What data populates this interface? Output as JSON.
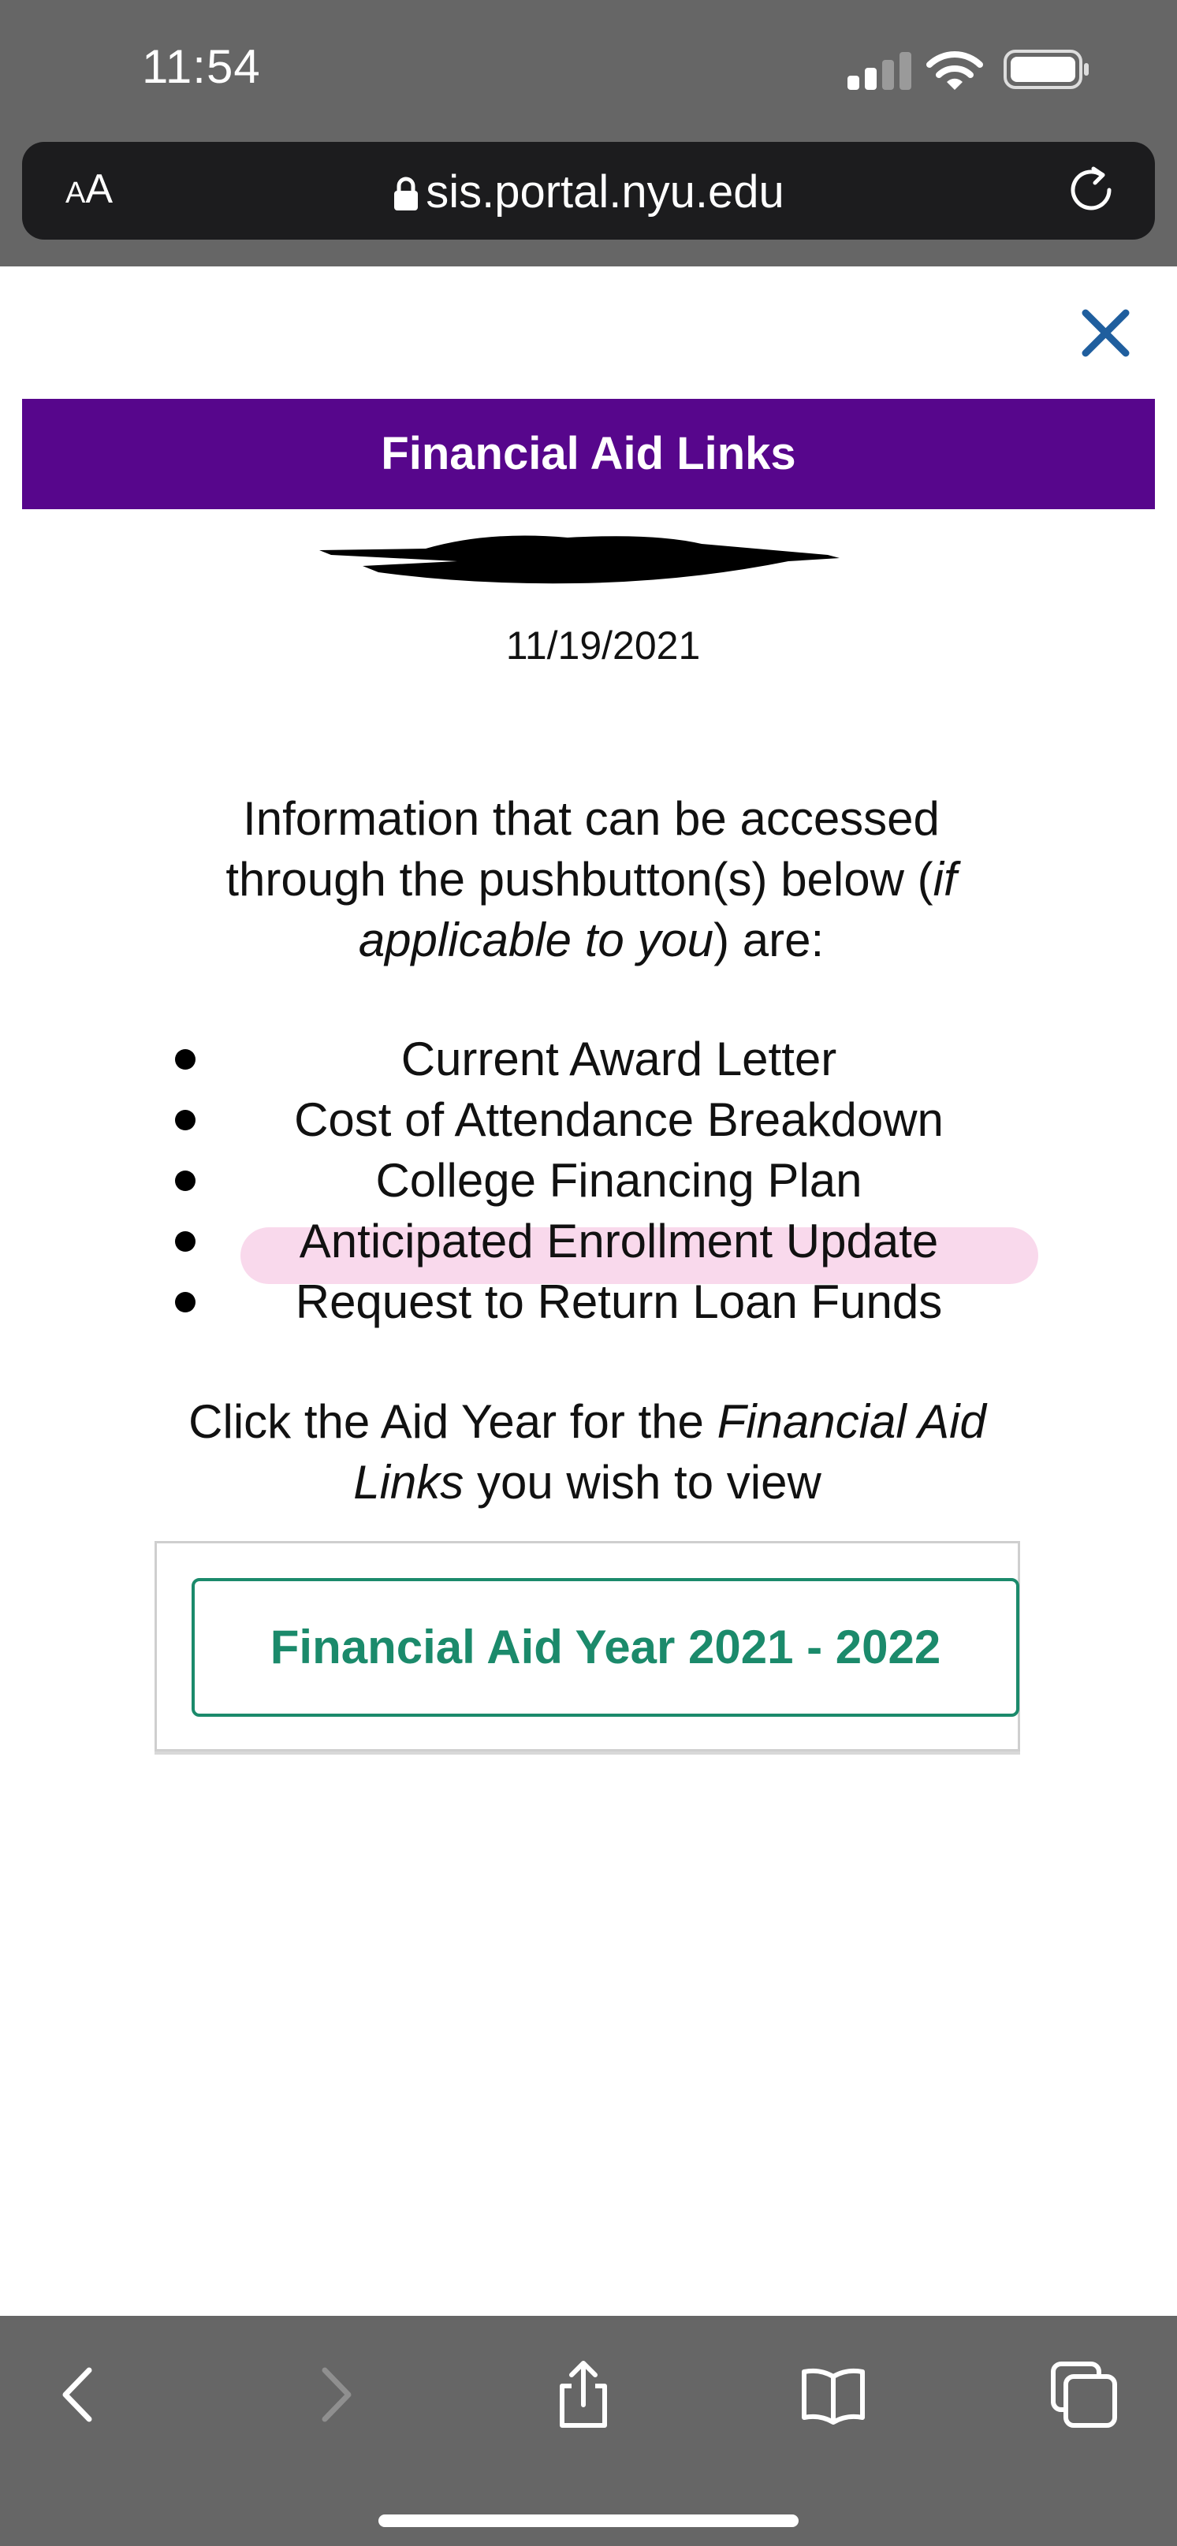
{
  "status_bar": {
    "time": "11:54"
  },
  "browser": {
    "text_size_label_small": "A",
    "text_size_label_large": "A",
    "url": "sis.portal.nyu.edu"
  },
  "colors": {
    "header": "#57068c",
    "button": "#1b8a6b",
    "highlight": "#f9d9ec",
    "chrome": "#666666"
  },
  "page": {
    "title": "Financial Aid Links",
    "date": "11/19/2021",
    "intro": {
      "part1": "Information that can be accessed through the pushbutton(s) below (",
      "italic": "if applicable to you",
      "part2": ") are:"
    },
    "info_items": [
      "Current Award Letter",
      "Cost of Attendance Breakdown",
      "College Financing Plan",
      "Anticipated Enrollment Update",
      "Request to Return Loan Funds"
    ],
    "click_msg": {
      "part1": "Click the Aid Year for the ",
      "italic": "Financial Aid Links",
      "part2": " you wish to view"
    },
    "aid_year_button": "Financial Aid Year 2021 - 2022"
  },
  "icons": {
    "close": "close-icon",
    "lock": "lock-icon",
    "reload": "reload-icon",
    "back": "chevron-left-icon",
    "forward": "chevron-right-icon",
    "share": "share-icon",
    "bookmarks": "book-icon",
    "tabs": "tabs-icon"
  }
}
